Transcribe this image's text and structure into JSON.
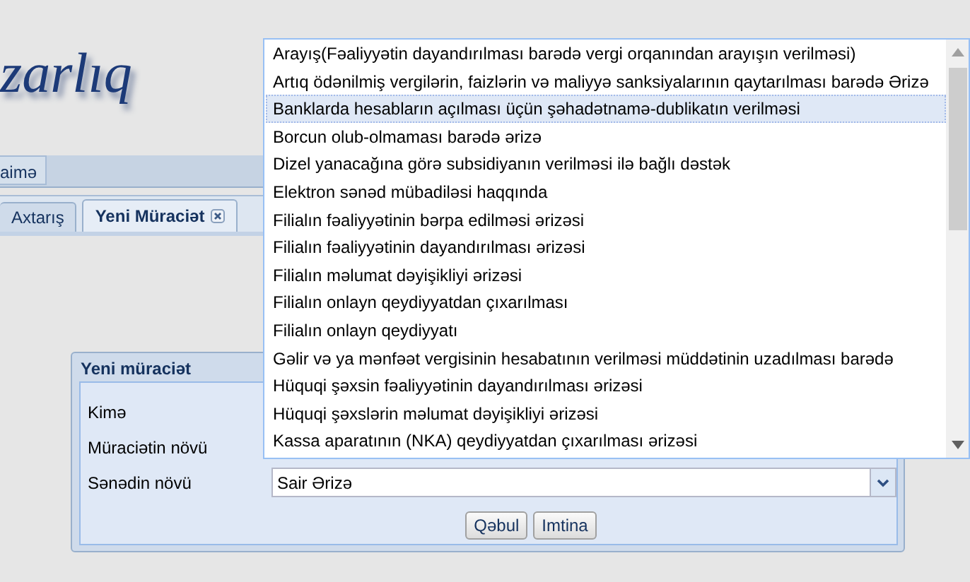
{
  "header": {
    "title": "zarlıq"
  },
  "menu": {
    "items": [
      {
        "label": "aimə",
        "selected": false
      }
    ]
  },
  "tabs": [
    {
      "label": "Axtarış",
      "selected": false,
      "closable": false
    },
    {
      "label": "Yeni Müraciət",
      "selected": true,
      "closable": true
    }
  ],
  "dialog": {
    "title": "Yeni müraciət",
    "fields": [
      {
        "label": "Kimə"
      },
      {
        "label": "Müraciətin növü"
      },
      {
        "label": "Sənədin növü",
        "value": "Sair Ərizə"
      }
    ],
    "buttons": [
      "Qəbul",
      "Imtina"
    ]
  },
  "dropdown": {
    "items": [
      {
        "label": "Arayış(Fəaliyyətin dayandırılması barədə vergi orqanından arayışın verilməsi)",
        "selected": false
      },
      {
        "label": "Artıq ödənilmiş vergilərin, faizlərin və maliyyə sanksiyalarının qaytarılması barədə Ərizə",
        "selected": false
      },
      {
        "label": "Banklarda hesabların açılması üçün şəhadətnamə-dublikatın verilməsi",
        "selected": true
      },
      {
        "label": "Borcun olub-olmaması barədə ərizə",
        "selected": false
      },
      {
        "label": "Dizel yanacağına görə subsidiyanın verilməsi ilə bağlı dəstək",
        "selected": false
      },
      {
        "label": "Elektron sənəd mübadiləsi haqqında",
        "selected": false
      },
      {
        "label": "Filialın fəaliyyətinin bərpa edilməsi ərizəsi",
        "selected": false
      },
      {
        "label": "Filialın fəaliyyətinin dayandırılması ərizəsi",
        "selected": false
      },
      {
        "label": "Filialın məlumat dəyişikliyi ərizəsi",
        "selected": false
      },
      {
        "label": "Filialın onlayn qeydiyyatdan çıxarılması",
        "selected": false
      },
      {
        "label": "Filialın onlayn qeydiyyatı",
        "selected": false
      },
      {
        "label": "Gəlir və ya mənfəət vergisinin hesabatının verilməsi müddətinin uzadılması barədə",
        "selected": false
      },
      {
        "label": "Hüquqi şəxsin fəaliyyətinin dayandırılması ərizəsi",
        "selected": false
      },
      {
        "label": "Hüquqi şəxslərin məlumat dəyişikliyi ərizəsi",
        "selected": false
      },
      {
        "label": "Kassa aparatının (NKA) qeydiyyatdan çıxarılması ərizəsi",
        "selected": false
      }
    ]
  }
}
